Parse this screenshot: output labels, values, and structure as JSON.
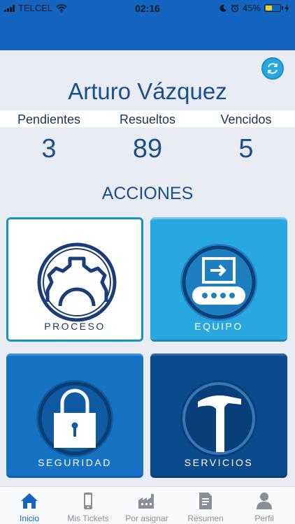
{
  "status_bar": {
    "carrier": "TELCEL",
    "time": "02:16",
    "battery": "45%",
    "battery_level": 0.45,
    "icons": [
      "signal-icon",
      "wifi-icon",
      "moon-icon",
      "alarm-icon",
      "battery-icon",
      "charging-icon"
    ]
  },
  "colors": {
    "header": "#1565c0",
    "accent": "#29a8e0",
    "text_blue": "#1a4f8b",
    "background": "#e9edf3"
  },
  "profile": {
    "name": "Arturo Vázquez",
    "refresh_icon": "refresh-icon"
  },
  "stats": [
    {
      "label": "Pendientes",
      "value": "3"
    },
    {
      "label": "Resueltos",
      "value": "89"
    },
    {
      "label": "Vencidos",
      "value": "5"
    }
  ],
  "actions": {
    "title": "ACCIONES",
    "tiles": [
      {
        "label": "PROCESO",
        "icon": "gear-icon"
      },
      {
        "label": "EQUIPO",
        "icon": "computer-icon"
      },
      {
        "label": "SEGURIDAD",
        "icon": "lock-icon"
      },
      {
        "label": "SERVICIOS",
        "icon": "hammer-icon"
      }
    ]
  },
  "tabbar": {
    "active": "Inicio",
    "tabs": [
      {
        "label": "Inicio",
        "icon": "home-icon"
      },
      {
        "label": "Mis Tickets",
        "icon": "phone-icon"
      },
      {
        "label": "Por asignar",
        "icon": "factory-icon"
      },
      {
        "label": "Resumen",
        "icon": "document-icon"
      },
      {
        "label": "Perfil",
        "icon": "person-icon"
      }
    ]
  }
}
